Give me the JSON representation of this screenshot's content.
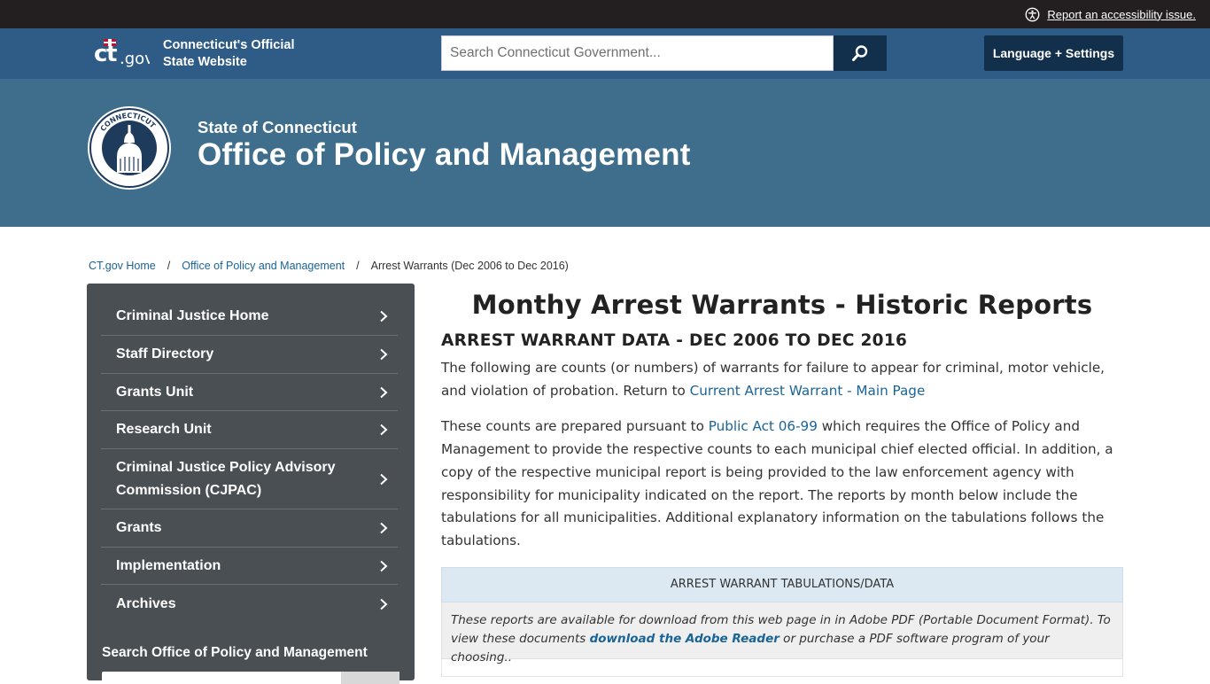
{
  "topbar": {
    "accessibility_label": "Report an accessibility issue."
  },
  "header": {
    "site_name_line1": "Connecticut's Official",
    "site_name_line2": "State Website",
    "search_placeholder": "Search Connecticut Government...",
    "language_button": "Language + Settings"
  },
  "banner": {
    "state": "State of Connecticut",
    "agency": "Office of Policy and Management"
  },
  "breadcrumb": [
    {
      "label": "CT.gov Home"
    },
    {
      "label": "Office of Policy and Management"
    },
    {
      "label": "Arrest Warrants (Dec 2006 to Dec 2016)"
    }
  ],
  "sidebar": {
    "items": [
      {
        "label": "Criminal Justice Home"
      },
      {
        "label": "Staff Directory"
      },
      {
        "label": "Grants Unit"
      },
      {
        "label": "Research Unit"
      },
      {
        "label": "Criminal Justice Policy Advisory",
        "label2": "Commission (CJPAC)"
      },
      {
        "label": "Grants"
      },
      {
        "label": "Implementation"
      },
      {
        "label": "Archives"
      }
    ],
    "search_label": "Search Office of Policy and Management"
  },
  "main": {
    "title": "Monthy Arrest Warrants - Historic Reports",
    "subtitle": "ARREST WARRANT DATA - DEC 2006 TO DEC 2016",
    "p1_text": "The following are counts (or numbers) of warrants for failure to appear for criminal, motor vehicle, and violation of probation. Return to ",
    "p1_link": "Current Arrest Warrant - Main Page",
    "p2_before": "These counts are prepared pursuant to ",
    "p2_link": "Public Act 06-99",
    "p2_after": " which requires the Office of Policy and Management to provide the respective counts to each municipal chief elected official.  In addition, a copy of the respective municipal report is being provided to the law enforcement agency with responsibility for municipality indicated on the report.  The reports by month below include the tabulations for all municipalities.  Additional explanatory information on the tabulations follows the tabulations.",
    "table_header": "ARREST WARRANT TABULATIONS/DATA",
    "note_before": "These reports are available for download from this web page in in Adobe PDF (Portable Document Format).  To view these documents ",
    "note_link": "download the Adobe Reader",
    "note_after": " or purchase a PDF software program of your choosing.."
  }
}
